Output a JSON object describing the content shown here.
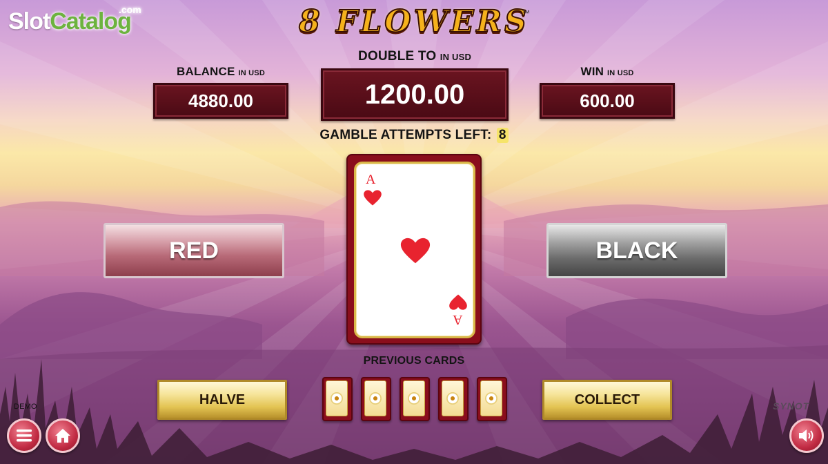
{
  "watermark": {
    "slot": "Slot",
    "catalog": "Catalog",
    "com": ".com"
  },
  "logo": {
    "text": "8 FLOWERS",
    "tm": "™"
  },
  "balance": {
    "label": "BALANCE",
    "unit": "IN USD",
    "value": "4880.00"
  },
  "double_to": {
    "label": "DOUBLE TO",
    "unit": "IN USD",
    "value": "1200.00"
  },
  "win": {
    "label": "WIN",
    "unit": "IN USD",
    "value": "600.00"
  },
  "gamble": {
    "label": "GAMBLE ATTEMPTS LEFT:",
    "value": "8"
  },
  "buttons": {
    "red": "RED",
    "black": "BLACK",
    "halve": "HALVE",
    "collect": "COLLECT"
  },
  "card": {
    "rank": "A",
    "suit": "hearts",
    "color": "#e8232f"
  },
  "previous_cards": {
    "label": "PREVIOUS CARDS",
    "count": 5
  },
  "demo_label": "DEMO",
  "provider": "SYNOT",
  "icons": {
    "menu": "menu-icon",
    "home": "home-icon",
    "sound": "speaker-icon"
  }
}
